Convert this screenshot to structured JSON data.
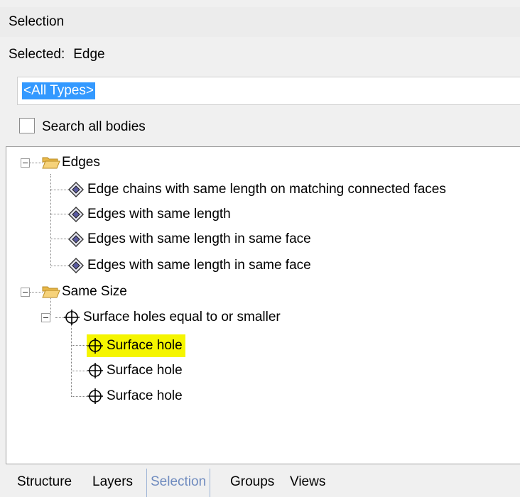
{
  "panel": {
    "title": "Selection",
    "selected_label": "Selected:",
    "selected_value": "Edge",
    "type_filter_value": "<All Types>",
    "search_all_bodies_label": "Search all bodies",
    "search_all_bodies_checked": false
  },
  "tree": {
    "groups": [
      {
        "label": "Edges",
        "expanded": true,
        "items": [
          "Edge chains with same length on matching connected faces",
          "Edges with same length",
          "Edges with same length in same face",
          "Edges with same length in same face"
        ]
      },
      {
        "label": "Same Size",
        "expanded": true,
        "subgroup": {
          "label": "Surface holes equal to or smaller",
          "items": [
            "Surface hole",
            "Surface hole",
            "Surface hole"
          ],
          "highlighted_index": 0
        }
      }
    ],
    "highlight_color": "#f5f500"
  },
  "tabs": [
    {
      "label": "Structure",
      "active": false
    },
    {
      "label": "Layers",
      "active": false
    },
    {
      "label": "Selection",
      "active": true
    },
    {
      "label": "Groups",
      "active": false
    },
    {
      "label": "Views",
      "active": false
    }
  ],
  "icons": {
    "group": "folder-icon",
    "edge_item": "edge-diamond-icon",
    "hole_item": "crosshair-circle-icon"
  },
  "colors": {
    "selection_blue": "#3399ff",
    "active_tab_text": "#6f8bbf"
  }
}
